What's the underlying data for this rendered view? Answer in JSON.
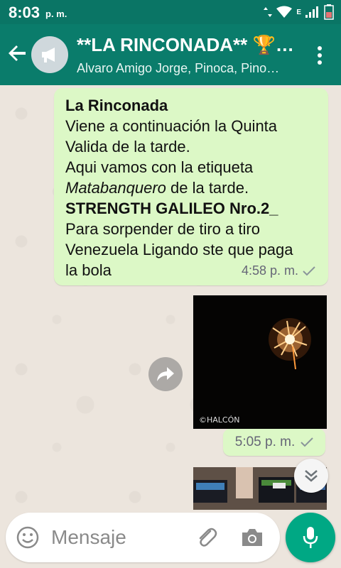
{
  "status_bar": {
    "time": "8:03",
    "ampm": "p. m.",
    "network_label": "E"
  },
  "header": {
    "title": "**LA RINCONADA** 🏆 …",
    "subtitle": "Alvaro Amigo Jorge, Pinoca, Pino…"
  },
  "messages": [
    {
      "lines": [
        {
          "text": "La Rinconada",
          "style": "bold"
        },
        {
          "text": "Viene a continuación la Quinta",
          "style": "normal"
        },
        {
          "text": "Valida de la tarde.",
          "style": "normal"
        },
        {
          "text": "Aqui vamos con la etiqueta",
          "style": "normal"
        },
        {
          "italic": "Matabanquero",
          "rest": " de la tarde.",
          "style": "mixed"
        },
        {
          "text": "STRENGTH GALILEO Nro.2_",
          "style": "bold"
        },
        {
          "text": "Para sorpender de tiro a tiro",
          "style": "normal"
        },
        {
          "text": "Venezuela Ligando ste que paga",
          "style": "normal"
        },
        {
          "text": "la bola",
          "style": "normal"
        }
      ],
      "time": "4:58 p. m."
    },
    {
      "image_credit": "©HALCÓN",
      "time": "5:05 p. m."
    }
  ],
  "input": {
    "placeholder": "Mensaje"
  },
  "colors": {
    "header": "#0a7c6b",
    "status_bar": "#0a7565",
    "outgoing_bubble": "#dcf8c6",
    "mic_button": "#00a884"
  },
  "icons": [
    "back-arrow-icon",
    "megaphone-icon",
    "more-vert-icon",
    "forward-icon",
    "chevron-down-icon",
    "emoji-icon",
    "attach-icon",
    "camera-icon",
    "mic-icon",
    "check-icon"
  ]
}
